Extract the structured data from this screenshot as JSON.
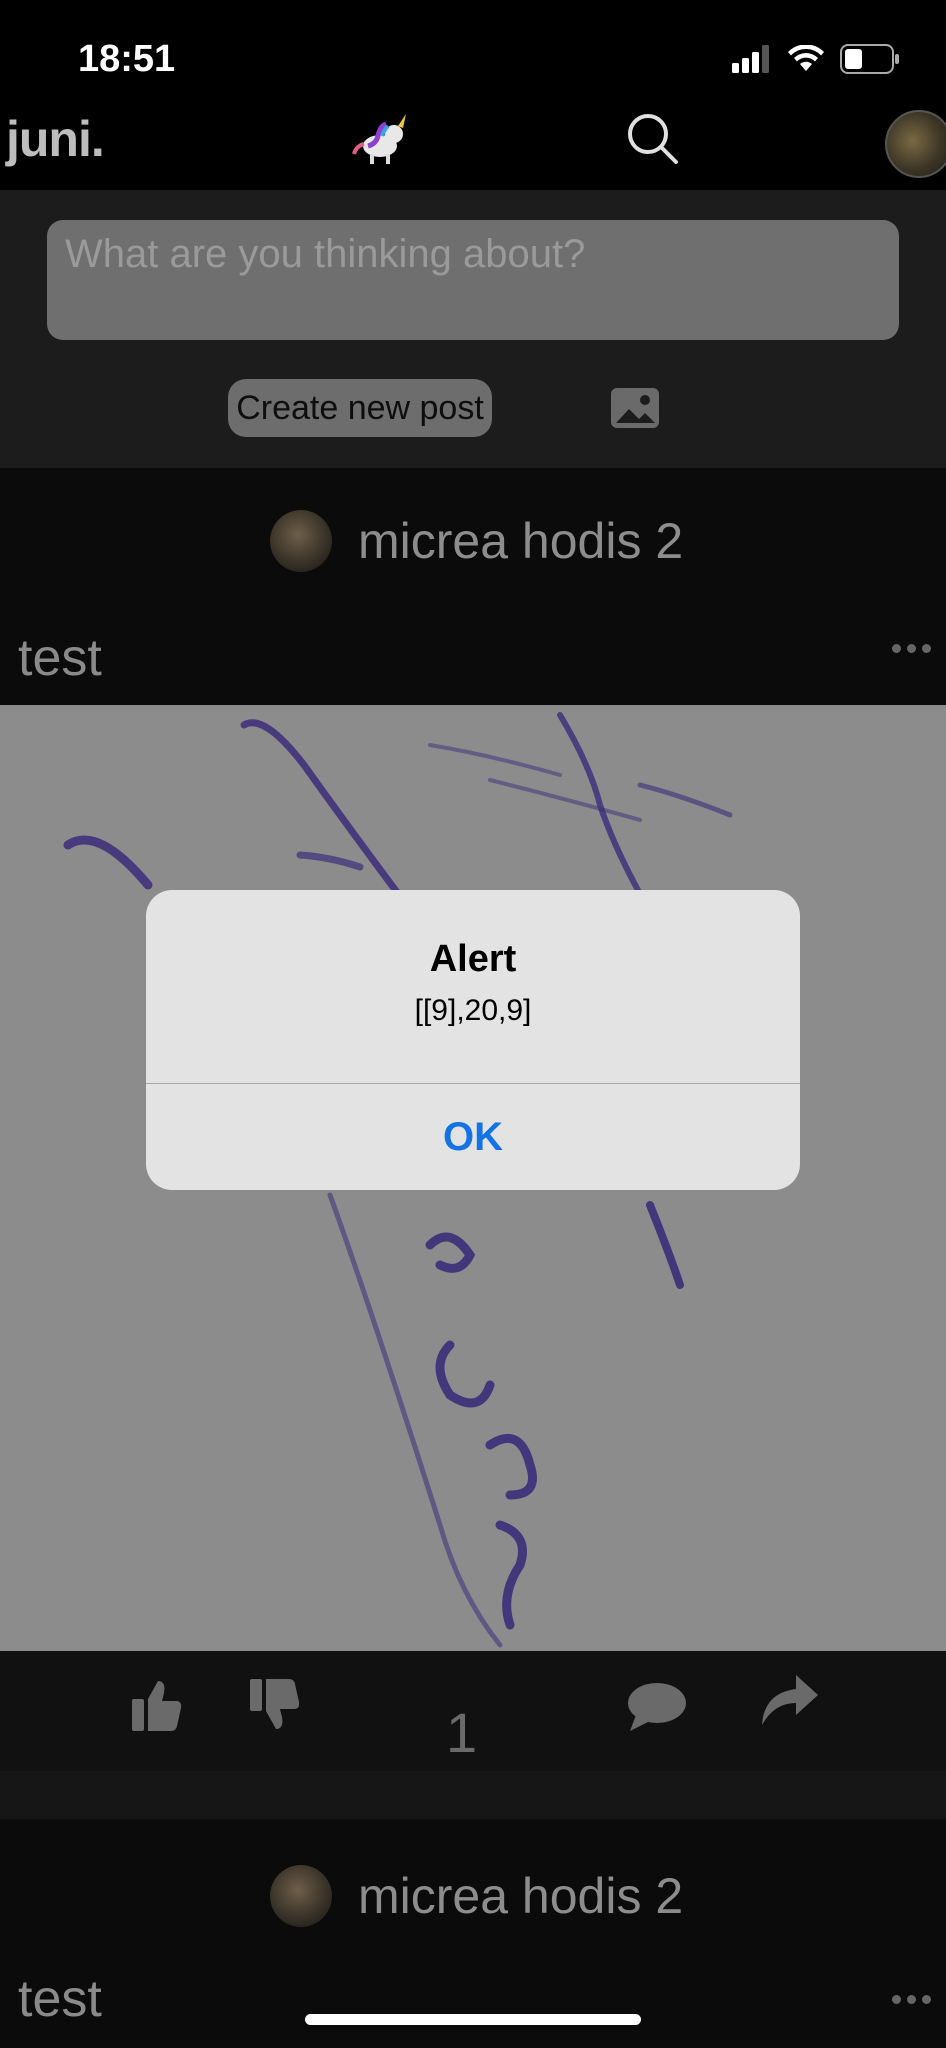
{
  "status_bar": {
    "time": "18:51"
  },
  "app": {
    "logo_text": "juni."
  },
  "composer": {
    "placeholder": "What are you thinking about?",
    "create_button": "Create new post"
  },
  "posts": [
    {
      "author": "micrea hodis 2",
      "title": "test",
      "vote_count": "1"
    },
    {
      "author": "micrea hodis 2",
      "title": "test"
    }
  ],
  "alert": {
    "title": "Alert",
    "message": "[[9],20,9]",
    "ok_label": "OK"
  },
  "colors": {
    "alert_button": "#1272e6",
    "background": "#000000"
  },
  "icons": [
    "signal-icon",
    "wifi-icon",
    "battery-icon",
    "unicorn-logo-icon",
    "search-icon",
    "image-icon",
    "thumbs-up-icon",
    "thumbs-down-icon",
    "comment-icon",
    "share-icon",
    "more-icon"
  ]
}
